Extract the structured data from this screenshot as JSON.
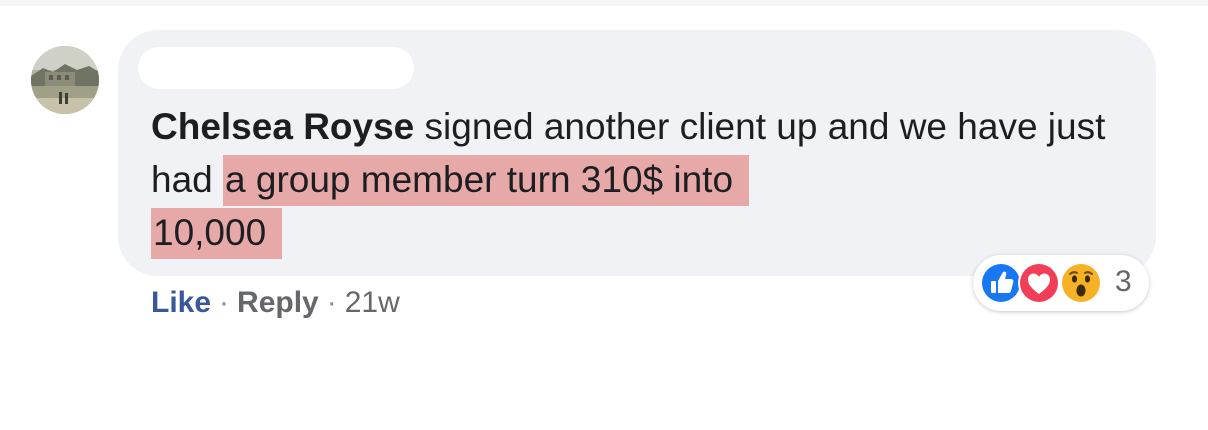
{
  "comment": {
    "mention": "Chelsea Royse",
    "text_plain": " signed another client up and we have just had ",
    "text_highlight_1": "a group member turn 310$ into",
    "text_highlight_2": "10,000",
    "highlight_color": "#e7a8a8"
  },
  "actions": {
    "like_label": "Like",
    "separator": "·",
    "reply_label": "Reply",
    "timestamp": "21w"
  },
  "reactions": {
    "icons": [
      "like-reaction-icon",
      "love-reaction-icon",
      "wow-reaction-icon"
    ],
    "count": "3"
  },
  "colors": {
    "bubble": "#f0f2f5",
    "link": "#385898",
    "meta": "#65676b"
  }
}
